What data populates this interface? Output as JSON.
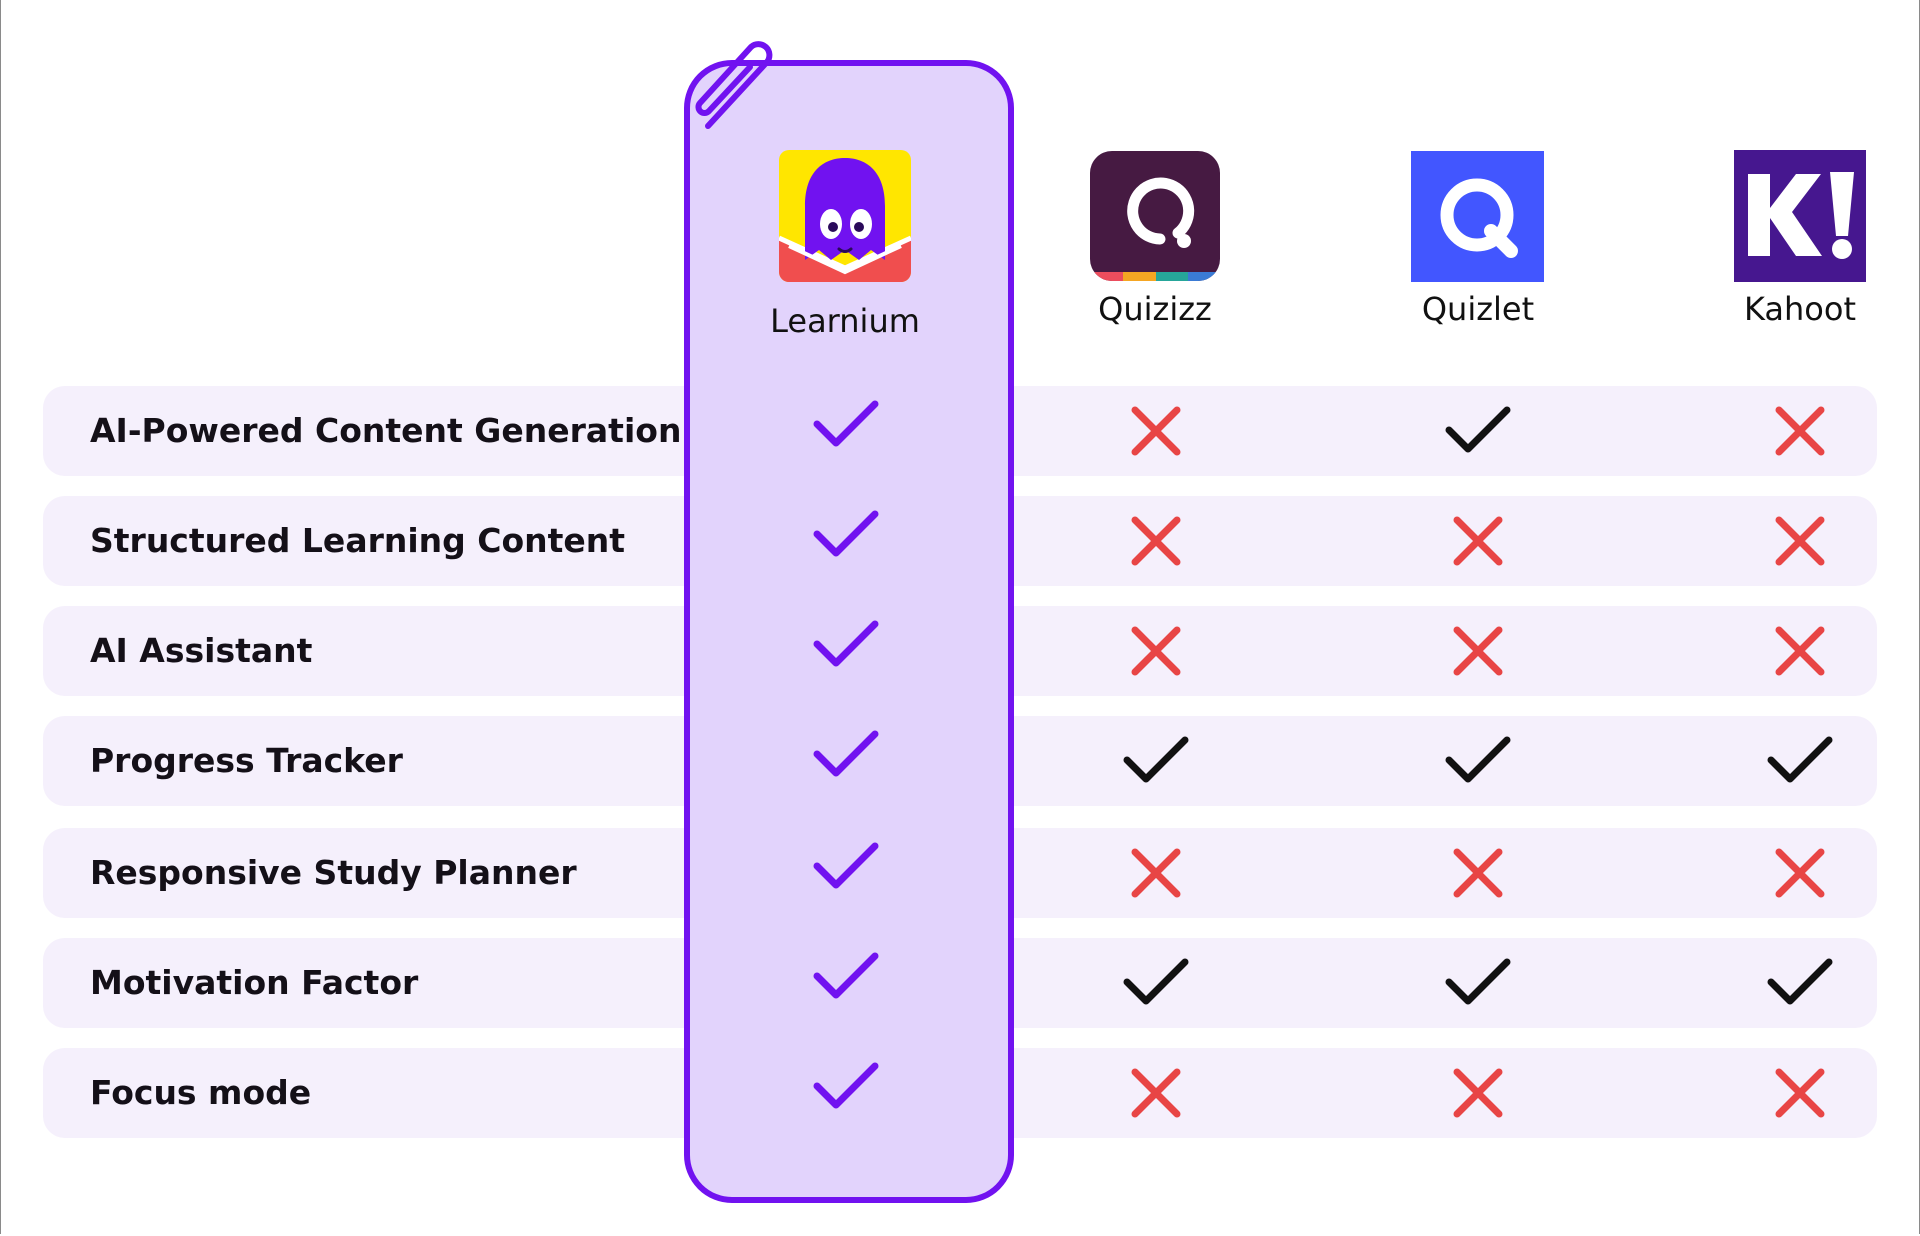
{
  "colors": {
    "highlight_border": "#7112f0",
    "highlight_fill": "#e2d3fc",
    "row_background": "#f5f0fc",
    "check_highlight": "#7112f0",
    "check_default": "#111111",
    "cross": "#e84545",
    "quizizz_bg": "#461a42",
    "quizlet_bg": "#4256ff",
    "kahoot_bg": "#46178f"
  },
  "apps": [
    {
      "name": "Learnium",
      "logo": "learnium-octopus-logo"
    },
    {
      "name": "Quizizz",
      "logo": "quizizz-q-logo"
    },
    {
      "name": "Quizlet",
      "logo": "quizlet-q-logo"
    },
    {
      "name": "Kahoot",
      "logo": "kahoot-k-logo"
    }
  ],
  "features": [
    {
      "label": "AI-Powered Content Generation",
      "marks": [
        "check",
        "cross",
        "check",
        "cross"
      ]
    },
    {
      "label": "Structured Learning Content",
      "marks": [
        "check",
        "cross",
        "cross",
        "cross"
      ]
    },
    {
      "label": "AI Assistant",
      "marks": [
        "check",
        "cross",
        "cross",
        "cross"
      ]
    },
    {
      "label": "Progress Tracker",
      "marks": [
        "check",
        "check",
        "check",
        "check"
      ]
    },
    {
      "label": "Responsive Study Planner",
      "marks": [
        "check",
        "cross",
        "cross",
        "cross"
      ]
    },
    {
      "label": "Motivation Factor",
      "marks": [
        "check",
        "check",
        "check",
        "check"
      ]
    },
    {
      "label": "Focus mode",
      "marks": [
        "check",
        "cross",
        "cross",
        "cross"
      ]
    }
  ],
  "icons": {
    "check": "check-icon",
    "cross": "cross-icon",
    "paperclip": "paperclip-icon"
  }
}
